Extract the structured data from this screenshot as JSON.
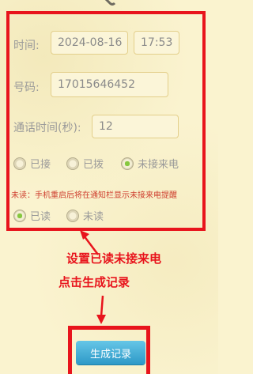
{
  "form": {
    "time_label": "时间:",
    "date_value": "2024-08-16",
    "time_value": "17:53",
    "number_label": "号码:",
    "number_value": "17015646452",
    "duration_label": "通话时间(秒):",
    "duration_value": "12",
    "call_types": [
      {
        "label": "已接",
        "selected": false
      },
      {
        "label": "已拨",
        "selected": false
      },
      {
        "label": "未接来电",
        "selected": true
      }
    ],
    "unread_note": "未读：手机重启后将在通知栏显示未接来电提醒",
    "read_options": [
      {
        "label": "已读",
        "selected": true
      },
      {
        "label": "未读",
        "selected": false
      }
    ]
  },
  "annotations": {
    "line1": "设置已读未接来电",
    "line2": "点击生成记录"
  },
  "actions": {
    "generate_label": "生成记录"
  },
  "colors": {
    "annotation_red": "#e8141c",
    "background": "#faf3cf",
    "radio_selected": "#86c83f",
    "button_blue": "#2d99c7"
  }
}
